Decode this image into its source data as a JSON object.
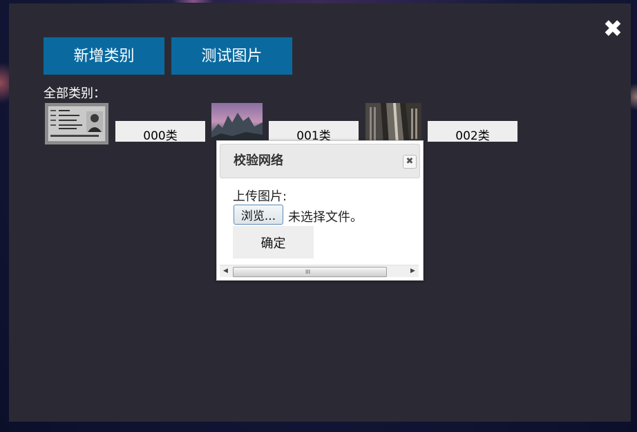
{
  "toolbar": {
    "add_category_label": "新增类别",
    "test_image_label": "测试图片"
  },
  "categories": {
    "heading": "全部类别：",
    "items": [
      {
        "label": "000类",
        "thumbnail_icon": "id-card-image-icon"
      },
      {
        "label": "001类",
        "thumbnail_icon": "mountain-image-icon"
      },
      {
        "label": "002类",
        "thumbnail_icon": "architecture-image-icon"
      }
    ]
  },
  "close_icon": "close-icon",
  "dialog": {
    "title": "校验网络",
    "close_icon": "close-icon",
    "upload_label": "上传图片:",
    "browse_label": "浏览...",
    "no_file_text": "未选择文件。",
    "confirm_label": "确定",
    "scroll_grip": "III",
    "scroll_left_icon": "arrow-left-icon",
    "scroll_right_icon": "arrow-right-icon"
  },
  "colors": {
    "panel_bg": "#2b2a34",
    "primary_button": "#0a6aa0",
    "tag_bg": "#eeeeee",
    "dialog_header": "#e9e9e9"
  }
}
